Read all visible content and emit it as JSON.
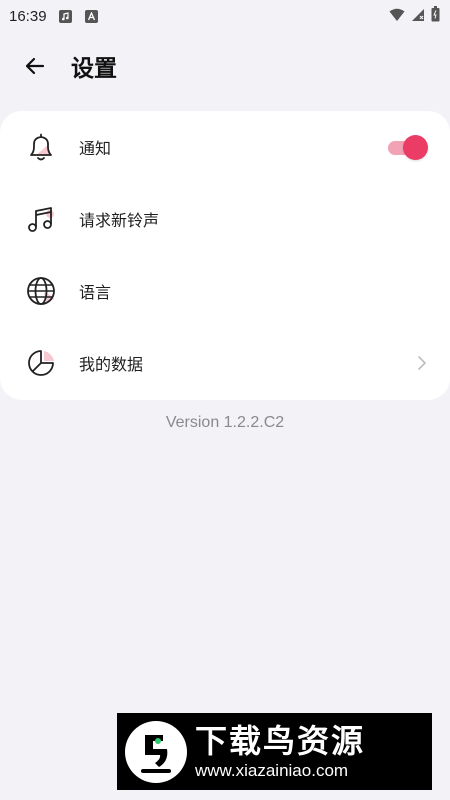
{
  "status_bar": {
    "time": "16:39"
  },
  "header": {
    "title": "设置"
  },
  "settings": [
    {
      "label": "通知",
      "icon": "bell-icon",
      "control": "toggle",
      "enabled": true
    },
    {
      "label": "请求新铃声",
      "icon": "music-note-icon"
    },
    {
      "label": "语言",
      "icon": "globe-icon"
    },
    {
      "label": "我的数据",
      "icon": "pie-chart-icon",
      "control": "chevron"
    }
  ],
  "version": "Version 1.2.2.C2",
  "watermark": {
    "title": "下载鸟资源",
    "url": "www.xiazainiao.com"
  },
  "colors": {
    "accent": "#ea3c64",
    "accent_light": "#f2a2b5",
    "background": "#f3f2f7",
    "card": "#ffffff"
  }
}
